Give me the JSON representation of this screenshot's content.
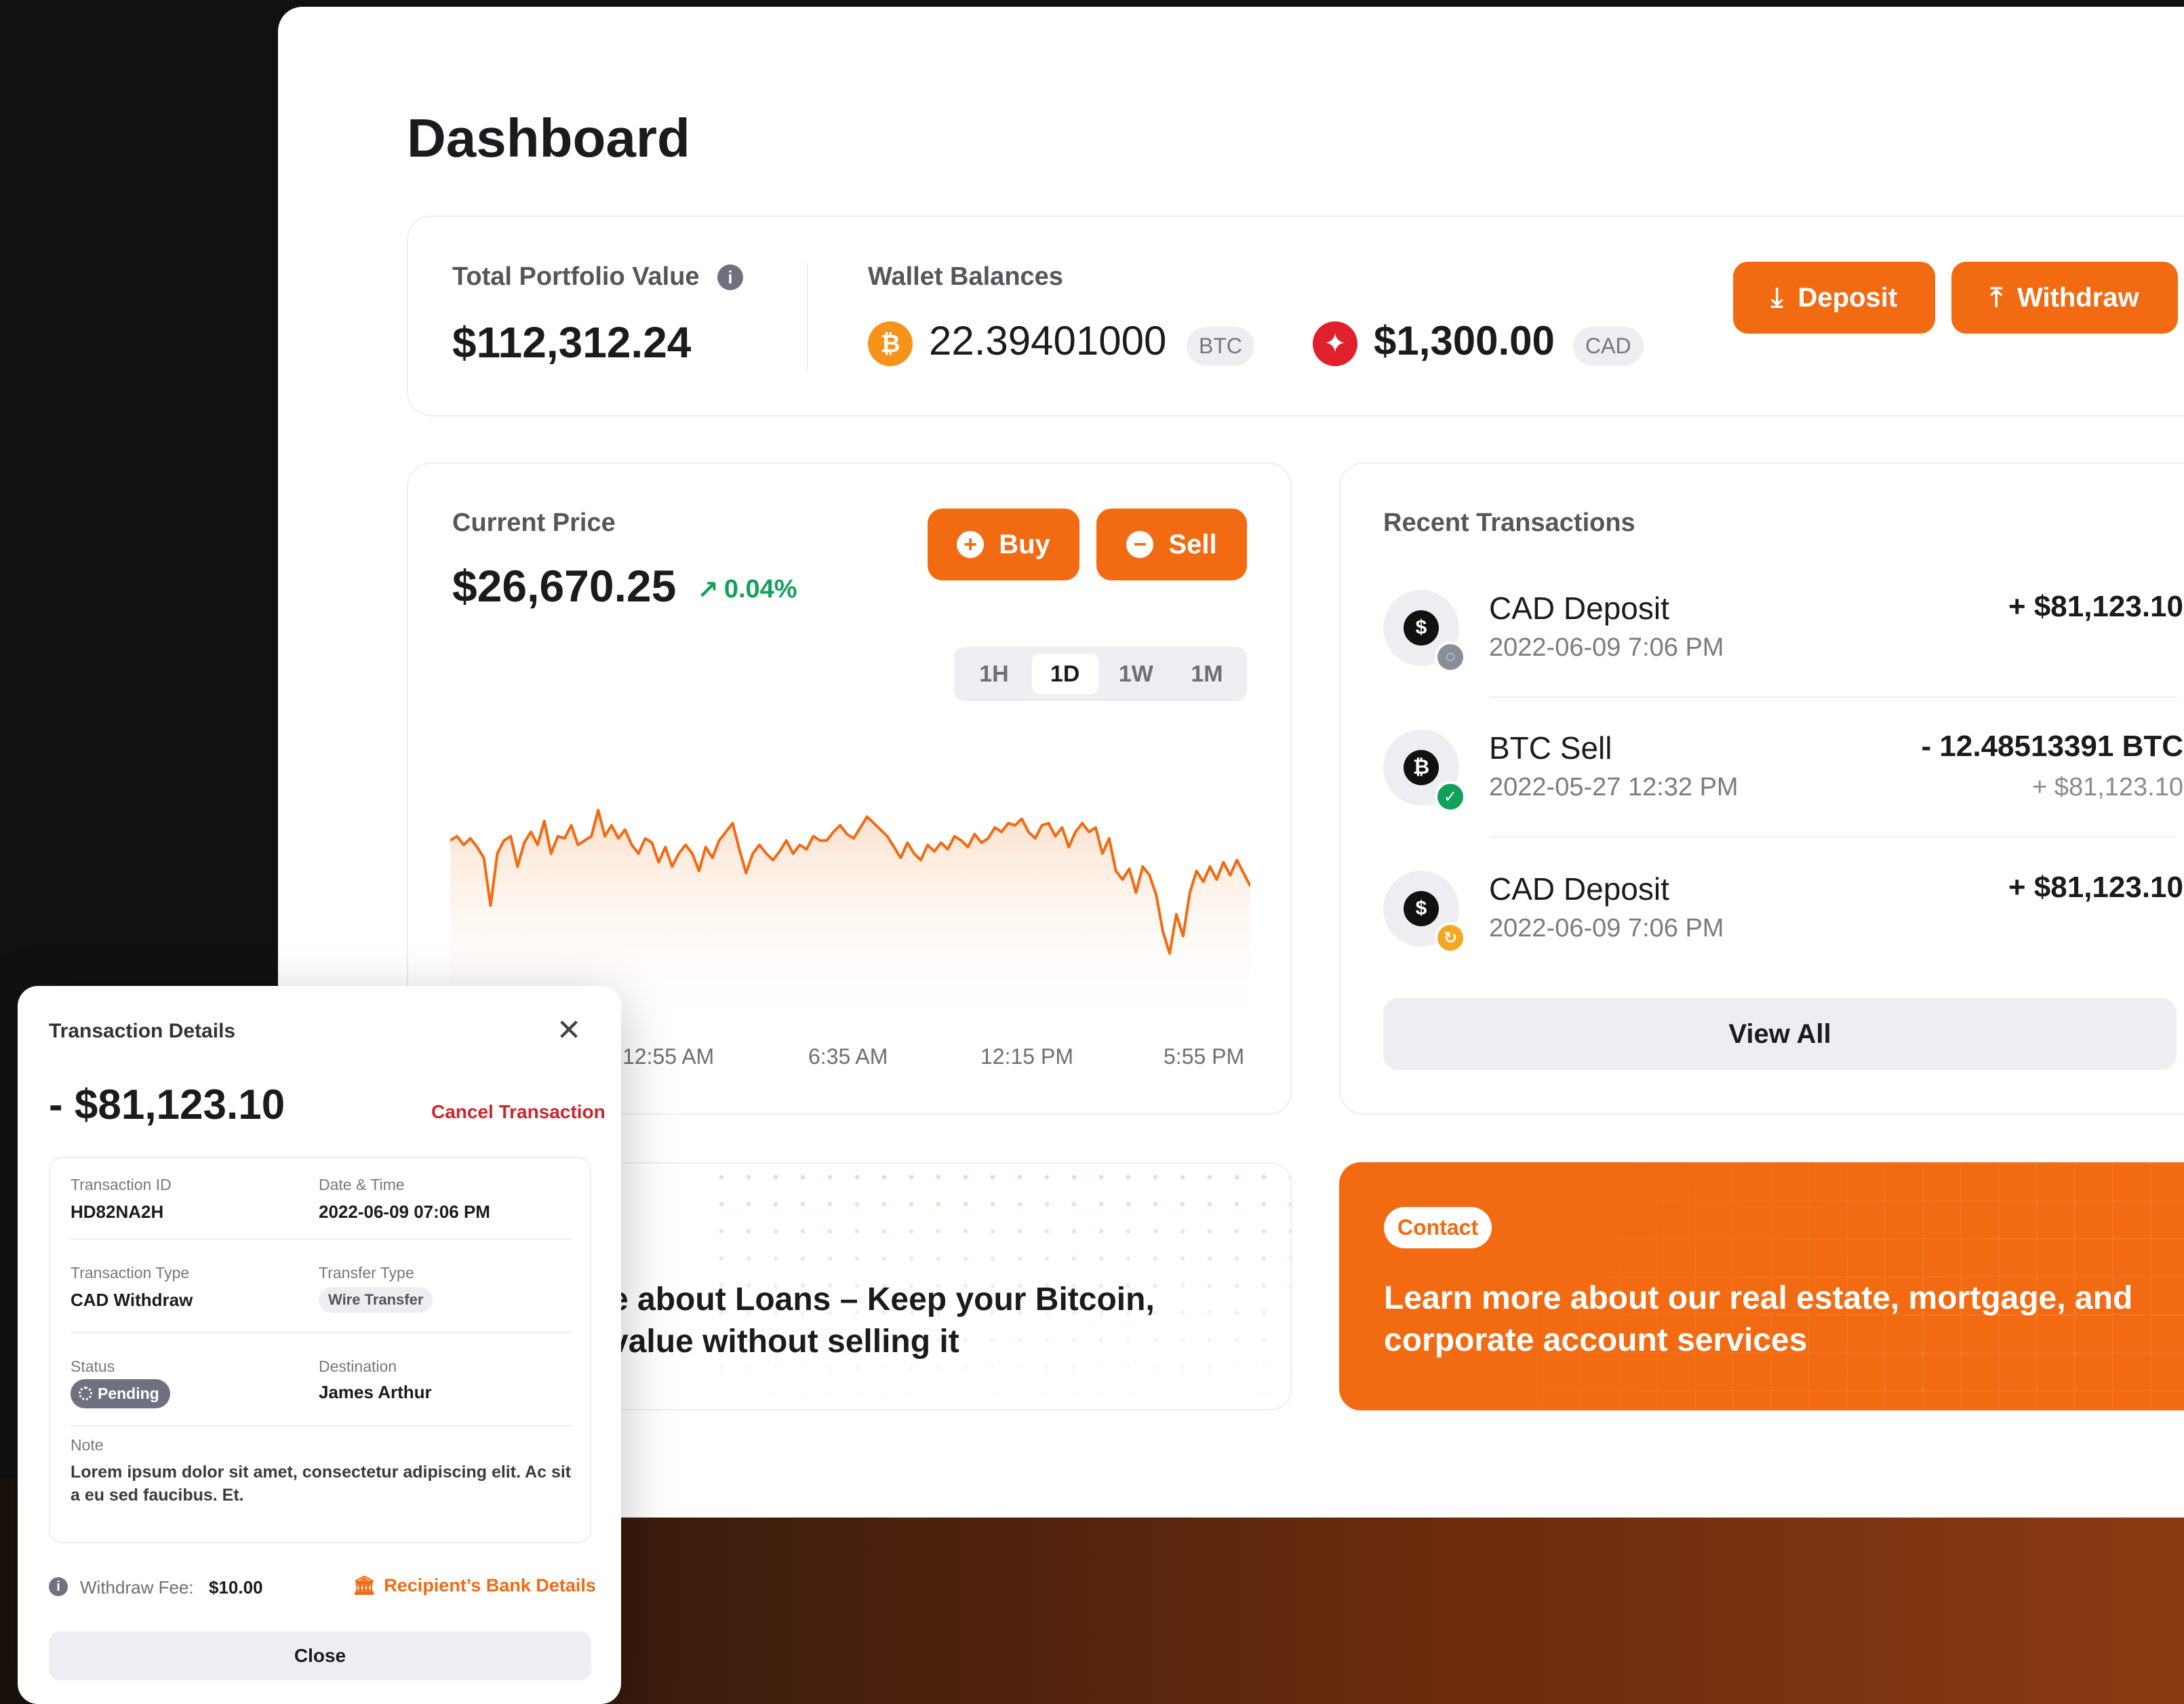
{
  "page": {
    "title": "Dashboard"
  },
  "colors": {
    "accent": "#f26a11",
    "positive": "#12a15a",
    "danger": "#d0242c"
  },
  "portfolio": {
    "label": "Total Portfolio Value",
    "value": "$112,312.24",
    "wallet_label": "Wallet Balances",
    "btc_amount": "22.39401000",
    "btc_unit": "BTC",
    "cad_amount": "$1,300.00",
    "cad_unit": "CAD",
    "deposit_label": "Deposit",
    "withdraw_label": "Withdraw"
  },
  "price": {
    "label": "Current Price",
    "value": "$26,670.25",
    "change": "0.04%",
    "buy_label": "Buy",
    "sell_label": "Sell",
    "ranges": [
      "1H",
      "1D",
      "1W",
      "1M"
    ],
    "active_range": "1D",
    "x_ticks": [
      "12:55 AM",
      "6:35 AM",
      "12:15 PM",
      "5:55 PM"
    ]
  },
  "chart_data": {
    "type": "area",
    "title": "",
    "xlabel": "",
    "ylabel": "",
    "x_ticks": [
      "12:55 AM",
      "6:35 AM",
      "12:15 PM",
      "5:55 PM"
    ],
    "ylim": [
      0,
      100
    ],
    "values": [
      72,
      74,
      70,
      73,
      69,
      64,
      42,
      66,
      72,
      74,
      60,
      71,
      76,
      70,
      81,
      66,
      74,
      73,
      79,
      70,
      72,
      74,
      86,
      74,
      79,
      73,
      77,
      70,
      66,
      73,
      71,
      62,
      69,
      60,
      66,
      70,
      66,
      58,
      69,
      64,
      72,
      76,
      80,
      68,
      57,
      66,
      70,
      66,
      63,
      67,
      72,
      66,
      70,
      68,
      74,
      72,
      72,
      76,
      79,
      75,
      73,
      78,
      83,
      80,
      77,
      74,
      69,
      64,
      71,
      66,
      63,
      70,
      67,
      71,
      68,
      74,
      72,
      69,
      75,
      71,
      73,
      78,
      76,
      80,
      79,
      82,
      76,
      73,
      79,
      80,
      74,
      78,
      69,
      76,
      80,
      76,
      78,
      66,
      73,
      58,
      54,
      59,
      48,
      60,
      56,
      47,
      30,
      20,
      38,
      28,
      48,
      58,
      53,
      60,
      54,
      62,
      56,
      63,
      57,
      51
    ]
  },
  "transactions": {
    "title": "Recent Transactions",
    "items": [
      {
        "icon": "S",
        "status": "pending",
        "title": "CAD Deposit",
        "date": "2022-06-09 7:06 PM",
        "amount": "+ $81,123.10",
        "sub": ""
      },
      {
        "icon": "B",
        "status": "complete",
        "title": "BTC Sell",
        "date": "2022-05-27 12:32 PM",
        "amount": "- 12.48513391 BTC",
        "sub": "+ $81,123.10"
      },
      {
        "icon": "S",
        "status": "processing",
        "title": "CAD Deposit",
        "date": "2022-06-09 7:06 PM",
        "amount": "+ $81,123.10",
        "sub": ""
      }
    ],
    "view_all_label": "View All"
  },
  "promos": {
    "loans_text_line1": "e about Loans – Keep your Bitcoin,",
    "loans_text_line2": "value without selling it",
    "contact_label": "Contact",
    "contact_text": "Learn more about our real estate, mortgage, and corporate account services"
  },
  "modal": {
    "title": "Transaction Details",
    "amount": "- $81,123.10",
    "cancel_label": "Cancel Transaction",
    "fields": {
      "txid_label": "Transaction ID",
      "txid": "HD82NA2H",
      "datetime_label": "Date & Time",
      "datetime": "2022-06-09 07:06 PM",
      "type_label": "Transaction Type",
      "type": "CAD Withdraw",
      "transfer_label": "Transfer Type",
      "transfer": "Wire Transfer",
      "status_label": "Status",
      "status": "Pending",
      "destination_label": "Destination",
      "destination": "James Arthur",
      "note_label": "Note",
      "note": "Lorem ipsum dolor sit amet, consectetur adipiscing elit. Ac sit a eu sed faucibus. Et."
    },
    "fee_label": "Withdraw Fee:",
    "fee_value": "$10.00",
    "bank_label": "Recipient’s Bank Details",
    "close_label": "Close"
  }
}
